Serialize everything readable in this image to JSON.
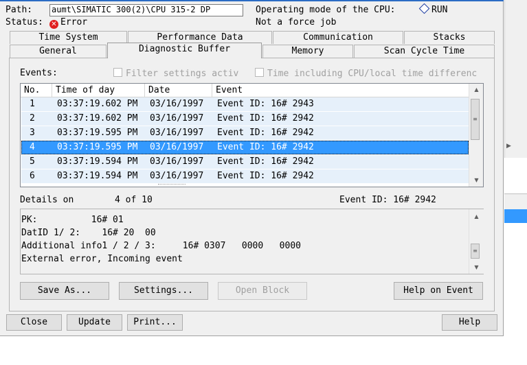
{
  "path": {
    "label": "Path:",
    "value": "aumt\\SIMATIC 300(2)\\CPU 315-2 DP"
  },
  "status": {
    "label": "Status:",
    "value": "Error"
  },
  "operating_mode": {
    "label": "Operating mode of the  CPU:",
    "value": "RUN"
  },
  "force_job": "Not a force job",
  "tabs_row1": [
    "Time System",
    "Performance Data",
    "Communication",
    "Stacks"
  ],
  "tabs_row2": [
    "General",
    "Diagnostic Buffer",
    "Memory",
    "Scan Cycle Time"
  ],
  "events": {
    "label": "Events:",
    "filter_label": "Filter settings activ",
    "time_label": "Time including CPU/local time differenc",
    "columns": [
      "No.",
      "Time of day",
      "Date",
      "Event"
    ],
    "rows": [
      {
        "no": "1",
        "time": "03:37:19.602 PM",
        "date": "03/16/1997",
        "event": "Event ID: 16# 2943"
      },
      {
        "no": "2",
        "time": "03:37:19.602 PM",
        "date": "03/16/1997",
        "event": "Event ID: 16# 2942"
      },
      {
        "no": "3",
        "time": "03:37:19.595 PM",
        "date": "03/16/1997",
        "event": "Event ID: 16# 2942"
      },
      {
        "no": "4",
        "time": "03:37:19.595 PM",
        "date": "03/16/1997",
        "event": "Event ID: 16# 2942"
      },
      {
        "no": "5",
        "time": "03:37:19.594 PM",
        "date": "03/16/1997",
        "event": "Event ID: 16# 2942"
      },
      {
        "no": "6",
        "time": "03:37:19.594 PM",
        "date": "03/16/1997",
        "event": "Event ID: 16# 2942"
      }
    ],
    "selected_index": 3
  },
  "details": {
    "label": "Details on",
    "position": "4 of 10",
    "event_id": "Event ID:  16# 2942",
    "lines": [
      "PK:          16# 01",
      "DatID 1/ 2:    16# 20  00",
      "Additional info1 / 2 / 3:     16# 0307   0000   0000",
      "External error, Incoming event"
    ]
  },
  "buttons": {
    "save_as": "Save As...",
    "settings": "Settings...",
    "open_block": "Open Block",
    "help_on_event": "Help on Event",
    "close": "Close",
    "update": "Update",
    "print": "Print...",
    "help": "Help"
  },
  "colors": {
    "selection": "#3399ff",
    "row_bg": "#e6f0fa",
    "error": "#e02020"
  }
}
